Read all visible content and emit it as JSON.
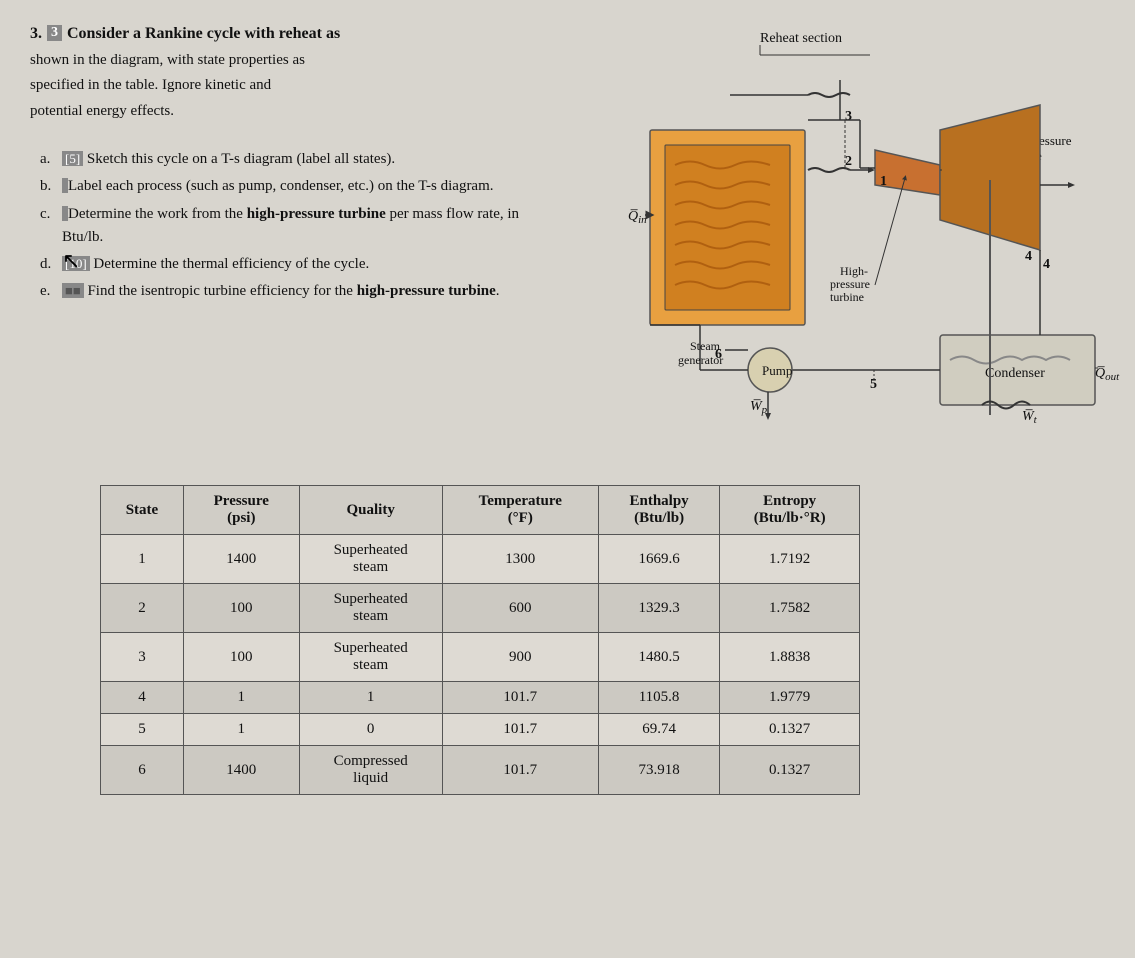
{
  "problem": {
    "number": "3.",
    "bracket": "3",
    "title": "Consider a Rankine cycle with reheat as",
    "line1": "shown in the diagram, with state properties as",
    "line2": "specified in the table. Ignore kinetic and",
    "line3": "potential energy effects.",
    "line4": ""
  },
  "sub_items": {
    "a": {
      "bracket": "[5]",
      "text": "Sketch this cycle on a T-s diagram (label all states)."
    },
    "b": {
      "bracket": "",
      "text": "Label each process (such as pump, condenser, etc.) on the T-s diagram."
    },
    "c": {
      "bracket": "",
      "text": "Determine the work from the high-pressure turbine per mass flow rate, in Btu/lb."
    },
    "d": {
      "bracket": "[10]",
      "text": "Determine the thermal efficiency of the cycle."
    },
    "e": {
      "bracket": "",
      "text": "Find the isentropic turbine efficiency for the high-pressure turbine."
    }
  },
  "diagram": {
    "reheat_label": "Reheat section",
    "low_pressure_label": "Low-pressure turbine",
    "high_pressure_label": "High-pressure turbine",
    "condenser_label": "Condenser",
    "pump_label": "Pump",
    "steam_generator_label": "Steam generator",
    "qin_label": "Qin",
    "qout_label": "Qout",
    "wp_label": "Wp",
    "wt_label": "Wt"
  },
  "table": {
    "headers": [
      "State",
      "Pressure\n(psi)",
      "Quality",
      "Temperature\n(°F)",
      "Enthalpy\n(Btu/lb)",
      "Entropy\n(Btu/lb·°R)"
    ],
    "rows": [
      {
        "state": "1",
        "pressure": "1400",
        "quality": "Superheated steam",
        "temperature": "1300",
        "enthalpy": "1669.6",
        "entropy": "1.7192"
      },
      {
        "state": "2",
        "pressure": "100",
        "quality": "Superheated steam",
        "temperature": "600",
        "enthalpy": "1329.3",
        "entropy": "1.7582"
      },
      {
        "state": "3",
        "pressure": "100",
        "quality": "Superheated steam",
        "temperature": "900",
        "enthalpy": "1480.5",
        "entropy": "1.8838"
      },
      {
        "state": "4",
        "pressure": "1",
        "quality": "1",
        "temperature": "101.7",
        "enthalpy": "1105.8",
        "entropy": "1.9779"
      },
      {
        "state": "5",
        "pressure": "1",
        "quality": "0",
        "temperature": "101.7",
        "enthalpy": "69.74",
        "entropy": "0.1327"
      },
      {
        "state": "6",
        "pressure": "1400",
        "quality": "Compressed liquid",
        "temperature": "101.7",
        "enthalpy": "73.918",
        "entropy": "0.1327"
      }
    ]
  }
}
